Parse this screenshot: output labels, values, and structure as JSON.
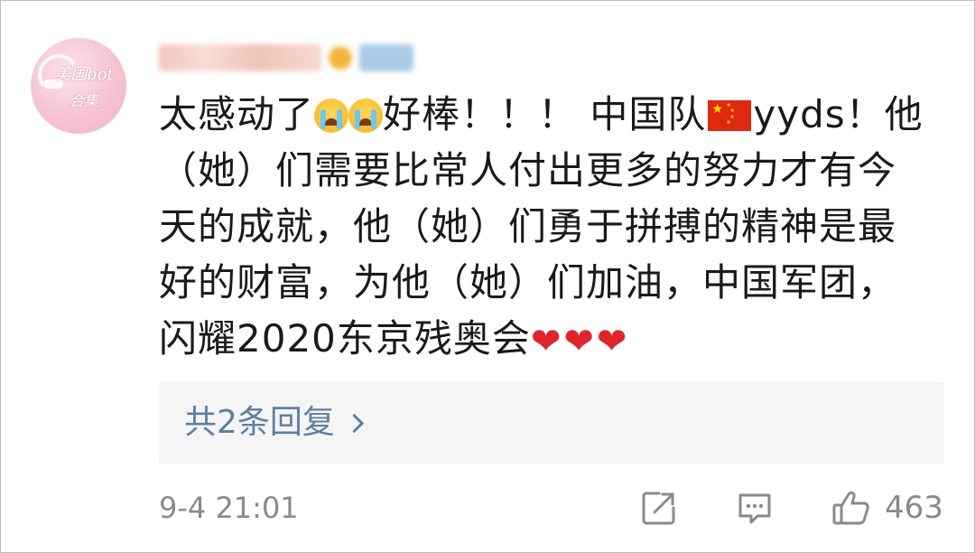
{
  "avatar": {
    "text_line1": "美国bot",
    "text_line2": "合集"
  },
  "comment": {
    "segments": {
      "s1": "太感动了",
      "s2": "好棒！！！ 中国队",
      "s3": "yyds！他（她）们需要比常人付出更多的努力才有今天的成就，他（她）们勇于拼搏的精神是最好的财富，为他（她）们加油，中国军团，闪耀2020东京残奥会"
    },
    "emoji": {
      "crying": "loudly-crying-face",
      "flag": "china-flag",
      "heart": "red-heart"
    },
    "hearts": [
      "❤",
      "❤",
      "❤"
    ]
  },
  "replies": {
    "label": "共2条回复"
  },
  "footer": {
    "timestamp": "9-4 21:01",
    "like_count": "463",
    "icons": {
      "share": "share-icon",
      "comment": "comment-icon",
      "like": "thumbs-up-icon"
    }
  },
  "colors": {
    "link": "#5e7fa3",
    "meta": "#8a8a8a",
    "replies_bg": "#f5f5f5",
    "heart": "#e0242c"
  }
}
